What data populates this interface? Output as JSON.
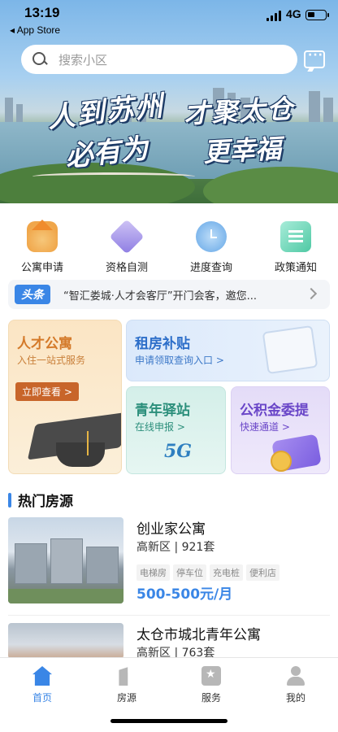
{
  "status_bar": {
    "time": "13:19",
    "back_app": "◂ App Store",
    "network": "4G"
  },
  "search": {
    "placeholder": "搜索小区"
  },
  "banner": {
    "slogan_left_1": "人到苏州",
    "slogan_left_2": "必有为",
    "slogan_right_1": "才聚太仓",
    "slogan_right_2": "更幸福"
  },
  "quick_links": [
    {
      "label": "公寓申请",
      "icon": "apartment-icon"
    },
    {
      "label": "资格自测",
      "icon": "pen-icon"
    },
    {
      "label": "进度查询",
      "icon": "clock-icon"
    },
    {
      "label": "政策通知",
      "icon": "document-icon"
    }
  ],
  "headline": {
    "tag": "头条",
    "text": "“智汇娄城·人才会客厅”开门会客，邀您..."
  },
  "cards": {
    "talent": {
      "title": "人才公寓",
      "subtitle": "入住一站式服务",
      "button": "立即查看 >"
    },
    "rent": {
      "title": "租房补贴",
      "subtitle": "申请领取查询入口 >"
    },
    "station": {
      "title": "青年驿站",
      "subtitle": "在线申报 >",
      "logo": "5G"
    },
    "fund": {
      "title": "公积金委提",
      "subtitle": "快速通道 >"
    }
  },
  "hot_section": {
    "title": "热门房源"
  },
  "listings": [
    {
      "name": "创业家公寓",
      "meta": "高新区 | 921套",
      "tags": [
        "电梯房",
        "停车位",
        "充电桩",
        "便利店"
      ],
      "price": "500-500元/月"
    },
    {
      "name": "太仓市城北青年公寓",
      "meta": "高新区 | 763套"
    }
  ],
  "tabbar": [
    {
      "label": "首页",
      "active": true
    },
    {
      "label": "房源",
      "active": false
    },
    {
      "label": "服务",
      "active": false
    },
    {
      "label": "我的",
      "active": false
    }
  ],
  "colors": {
    "accent": "#3a86e6",
    "talent": "#d47a2a",
    "station": "#2b8f7b",
    "fund": "#6a46c8"
  }
}
